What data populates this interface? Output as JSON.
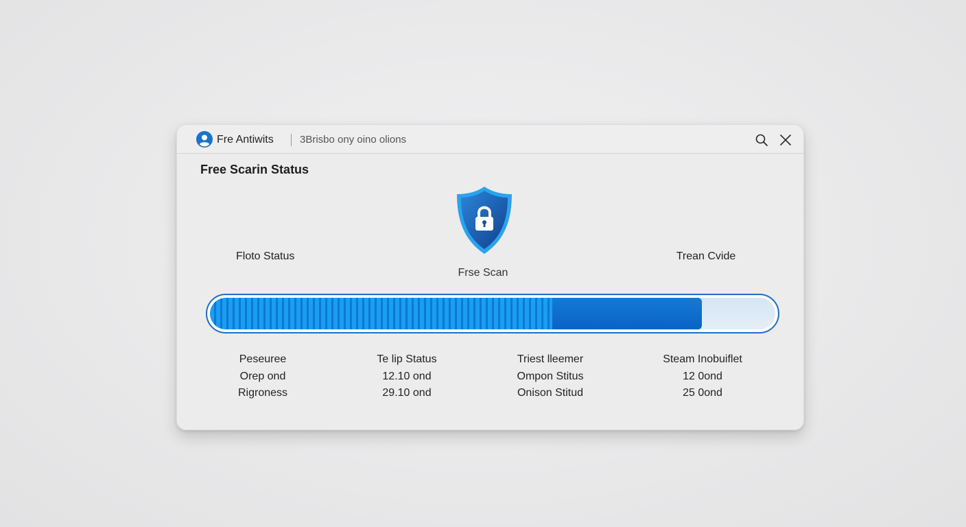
{
  "window": {
    "app_name": "Fre Antiwits",
    "subtitle": "3Brisbo ony oino olions"
  },
  "section_title": "Free Scarin Status",
  "labels": {
    "left": "Floto Status",
    "center": "Frse Scan",
    "right": "Trean Cvide"
  },
  "progress": {
    "fill_fraction": 0.87,
    "striped_fraction": 0.605
  },
  "stats": [
    {
      "rows": [
        "Peseuree",
        "Orep ond",
        "Rigroness"
      ]
    },
    {
      "rows": [
        "Te lip Status",
        "12.10 ond",
        "29.10 ond"
      ]
    },
    {
      "rows": [
        "Triest lleemer",
        "Ompon Stitus",
        "Onison Stitud"
      ]
    },
    {
      "rows": [
        "Steam Inobuiflet",
        "12 0ond",
        "25 0ond"
      ]
    }
  ],
  "colors": {
    "accent": "#1673d4",
    "stripe_light": "#1a9ef0",
    "track": "#d9e8f4",
    "shield": "#1f62b8"
  },
  "icons": {
    "app": "user-circle-icon",
    "search": "search-icon",
    "close": "close-icon",
    "shield": "shield-lock-icon"
  }
}
